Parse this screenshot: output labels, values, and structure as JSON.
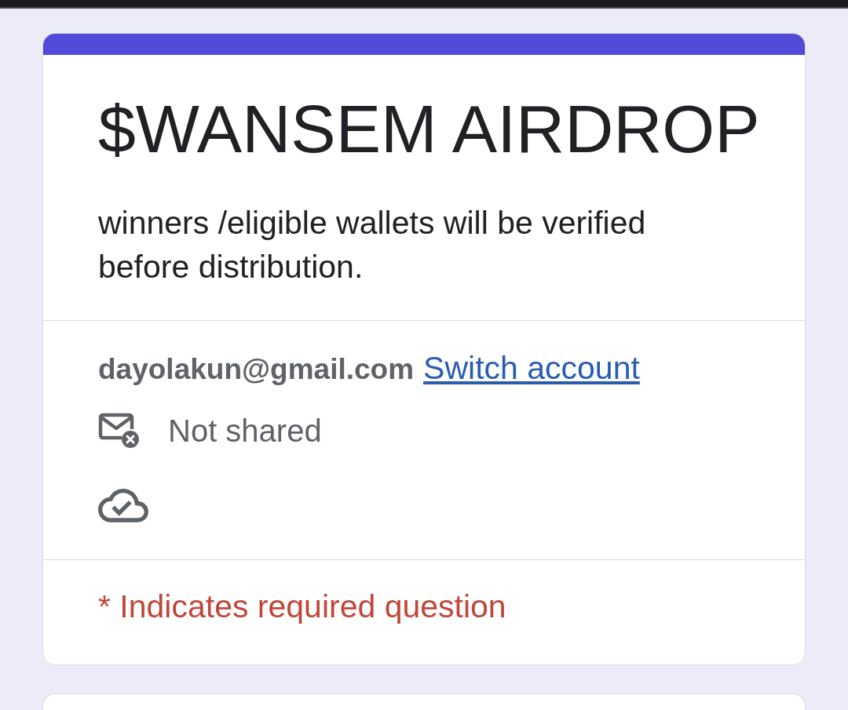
{
  "form": {
    "title": "$WANSEM AIRDROP",
    "description": "winners /eligible wallets will be verified before distribution."
  },
  "account": {
    "email": "dayolakun@gmail.com",
    "switch_link": "Switch account",
    "email_status": "Not shared"
  },
  "required_note": "* Indicates required question"
}
